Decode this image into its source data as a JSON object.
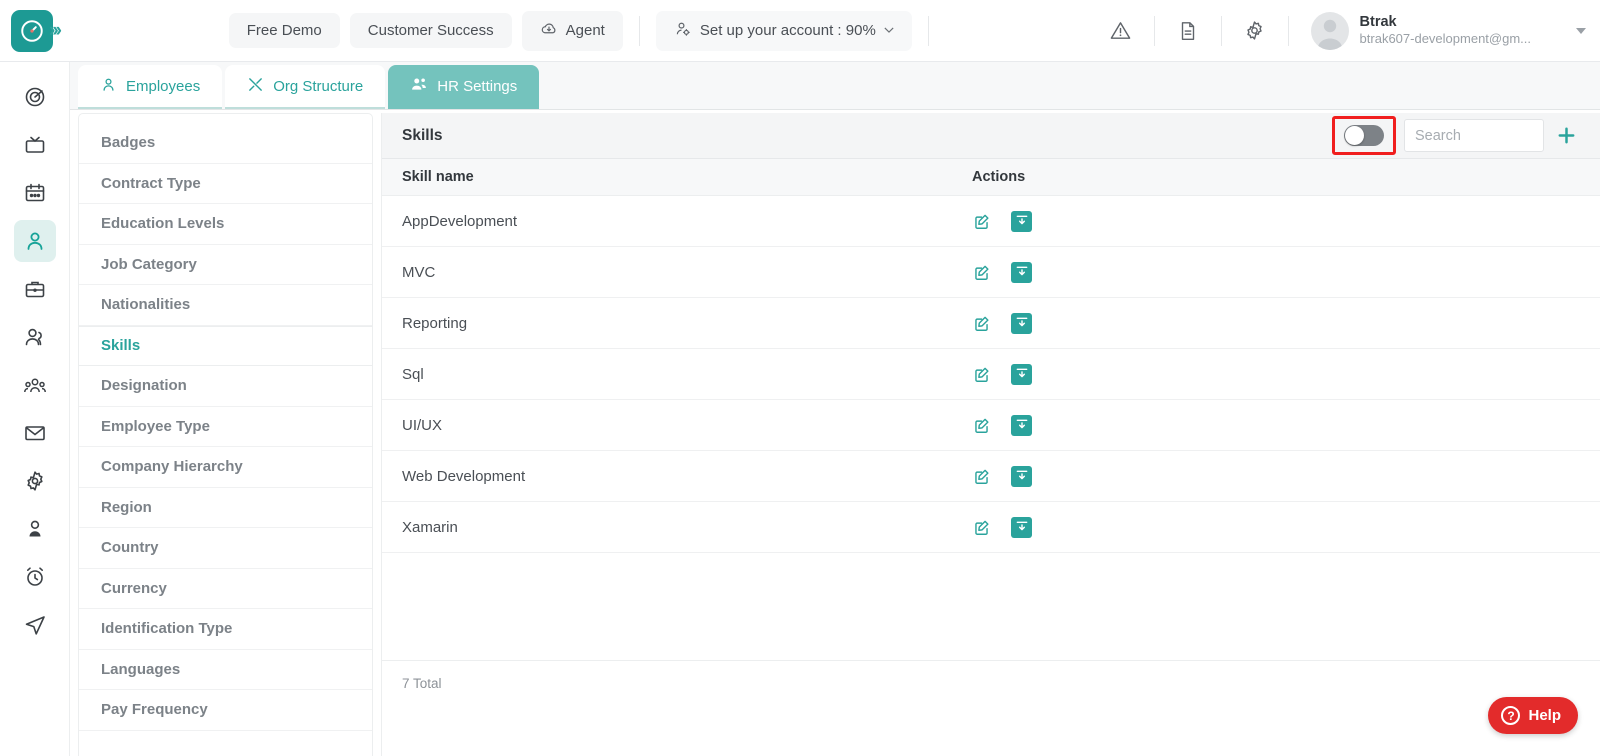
{
  "app": {
    "brand_color": "#2aa39c",
    "logo_icon": "clock-target-logo",
    "expand_icon": "chevrons-right-icon"
  },
  "topbar": {
    "nav_buttons": [
      {
        "label": "Free Demo",
        "icon": null
      },
      {
        "label": "Customer Success",
        "icon": null
      },
      {
        "label": "Agent",
        "icon": "cloud-download-icon"
      },
      {
        "label": "Set up your account : 90%",
        "icon": "account-setup-icon",
        "has_caret": true
      }
    ],
    "icons": [
      {
        "name": "warning-triangle-icon"
      },
      {
        "name": "document-icon"
      },
      {
        "name": "gear-icon"
      }
    ],
    "user": {
      "name": "Btrak",
      "email": "btrak607-development@gm...",
      "avatar_icon": "user-avatar",
      "caret_icon": "chevron-down-icon"
    }
  },
  "rail": {
    "items": [
      {
        "name": "target-icon",
        "active": false
      },
      {
        "name": "tv-icon",
        "active": false
      },
      {
        "name": "calendar-icon",
        "active": false
      },
      {
        "name": "person-icon",
        "active": true
      },
      {
        "name": "briefcase-icon",
        "active": false
      },
      {
        "name": "users-icon",
        "active": false
      },
      {
        "name": "team-icon",
        "active": false
      },
      {
        "name": "mail-icon",
        "active": false
      },
      {
        "name": "gear-icon",
        "active": false
      },
      {
        "name": "profile-icon",
        "active": false
      },
      {
        "name": "alarm-clock-icon",
        "active": false
      },
      {
        "name": "send-icon",
        "active": false
      }
    ]
  },
  "tabs": [
    {
      "label": "Employees",
      "icon": "person-outline-icon",
      "active": false
    },
    {
      "label": "Org Structure",
      "icon": "tools-icon",
      "active": false
    },
    {
      "label": "HR Settings",
      "icon": "users-gear-icon",
      "active": true
    }
  ],
  "settings_menu": {
    "items": [
      {
        "label": "Badges",
        "active": false
      },
      {
        "label": "Contract Type",
        "active": false
      },
      {
        "label": "Education Levels",
        "active": false
      },
      {
        "label": "Job Category",
        "active": false
      },
      {
        "label": "Nationalities",
        "active": false
      },
      {
        "label": "Skills",
        "active": true
      },
      {
        "label": "Designation",
        "active": false
      },
      {
        "label": "Employee Type",
        "active": false
      },
      {
        "label": "Company Hierarchy",
        "active": false
      },
      {
        "label": "Region",
        "active": false
      },
      {
        "label": "Country",
        "active": false
      },
      {
        "label": "Currency",
        "active": false
      },
      {
        "label": "Identification Type",
        "active": false
      },
      {
        "label": "Languages",
        "active": false
      },
      {
        "label": "Pay Frequency",
        "active": false
      }
    ]
  },
  "panel": {
    "title": "Skills",
    "toggle": {
      "state": "off",
      "highlighted": true,
      "highlight_color": "#f01e1e"
    },
    "search": {
      "placeholder": "Search",
      "value": ""
    },
    "add_button_icon": "plus-icon",
    "columns": [
      "Skill name",
      "Actions"
    ],
    "rows": [
      {
        "skill_name": "AppDevelopment",
        "edit_icon": "edit-pencil-icon",
        "archive_icon": "archive-download-icon"
      },
      {
        "skill_name": "MVC",
        "edit_icon": "edit-pencil-icon",
        "archive_icon": "archive-download-icon"
      },
      {
        "skill_name": "Reporting",
        "edit_icon": "edit-pencil-icon",
        "archive_icon": "archive-download-icon"
      },
      {
        "skill_name": "Sql",
        "edit_icon": "edit-pencil-icon",
        "archive_icon": "archive-download-icon"
      },
      {
        "skill_name": "UI/UX",
        "edit_icon": "edit-pencil-icon",
        "archive_icon": "archive-download-icon"
      },
      {
        "skill_name": "Web Development",
        "edit_icon": "edit-pencil-icon",
        "archive_icon": "archive-download-icon"
      },
      {
        "skill_name": "Xamarin",
        "edit_icon": "edit-pencil-icon",
        "archive_icon": "archive-download-icon"
      }
    ],
    "total_text": "7 Total"
  },
  "help": {
    "label": "Help",
    "icon": "question-mark-icon",
    "color": "#e32b2b"
  }
}
